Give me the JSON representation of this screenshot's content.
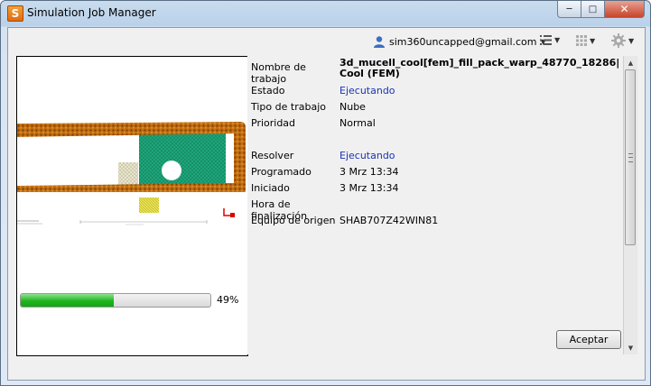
{
  "window": {
    "title": "Simulation Job Manager",
    "app_icon_letter": "S"
  },
  "toolbar": {
    "user": "sim360uncapped@gmail.com"
  },
  "preview": {
    "progress_fraction": 0.49,
    "progress_label": "49%"
  },
  "details": {
    "rows": [
      {
        "label": "Nombre de trabajo",
        "value": "3d_mucell_cool[fem]_fill_pack_warp_48770_18286| Cool (FEM)"
      },
      {
        "label": "Estado",
        "value": "Ejecutando"
      },
      {
        "label": "Tipo de trabajo",
        "value": "Nube"
      },
      {
        "label": "Prioridad",
        "value": "Normal"
      },
      {
        "label": "Resolver",
        "value": "Ejecutando"
      },
      {
        "label": "Programado",
        "value": "3 Mrz 13:34"
      },
      {
        "label": "Iniciado",
        "value": "3 Mrz 13:34"
      },
      {
        "label": "Hora de finalización",
        "value": ""
      },
      {
        "label": "Equipo de origen",
        "value": "SHAB707Z42WIN81"
      }
    ]
  },
  "buttons": {
    "accept": "Aceptar"
  },
  "colors": {
    "running": "#1a33b5",
    "progress": "#1fb51f"
  }
}
